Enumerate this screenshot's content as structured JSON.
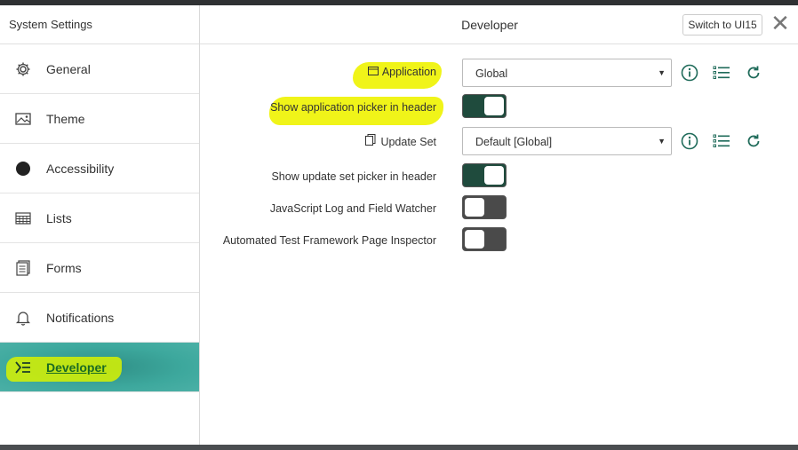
{
  "sidebar": {
    "title": "System Settings",
    "items": [
      {
        "label": "General",
        "icon": "gear-icon"
      },
      {
        "label": "Theme",
        "icon": "image-icon"
      },
      {
        "label": "Accessibility",
        "icon": "circle-icon"
      },
      {
        "label": "Lists",
        "icon": "table-icon"
      },
      {
        "label": "Forms",
        "icon": "form-icon"
      },
      {
        "label": "Notifications",
        "icon": "bell-icon"
      },
      {
        "label": "Developer",
        "icon": "developer-icon"
      }
    ],
    "active_index": 6
  },
  "header": {
    "title": "Developer",
    "switch_label": "Switch to UI15",
    "close_symbol": "✕"
  },
  "settings": {
    "application": {
      "label": "Application",
      "value": "Global"
    },
    "show_app_picker": {
      "label": "Show application picker in header",
      "on": true
    },
    "update_set": {
      "label": "Update Set",
      "value": "Default [Global]"
    },
    "show_update_set_picker": {
      "label": "Show update set picker in header",
      "on": true
    },
    "js_log": {
      "label": "JavaScript Log and Field Watcher",
      "on": false
    },
    "atf_inspector": {
      "label": "Automated Test Framework Page Inspector",
      "on": false
    }
  },
  "colors": {
    "accent": "#2f8f86",
    "toggle_on": "#1f4b3d",
    "toggle_off": "#4a4a4a",
    "highlight": "#eef300",
    "icon_green": "#1f6b5a"
  }
}
